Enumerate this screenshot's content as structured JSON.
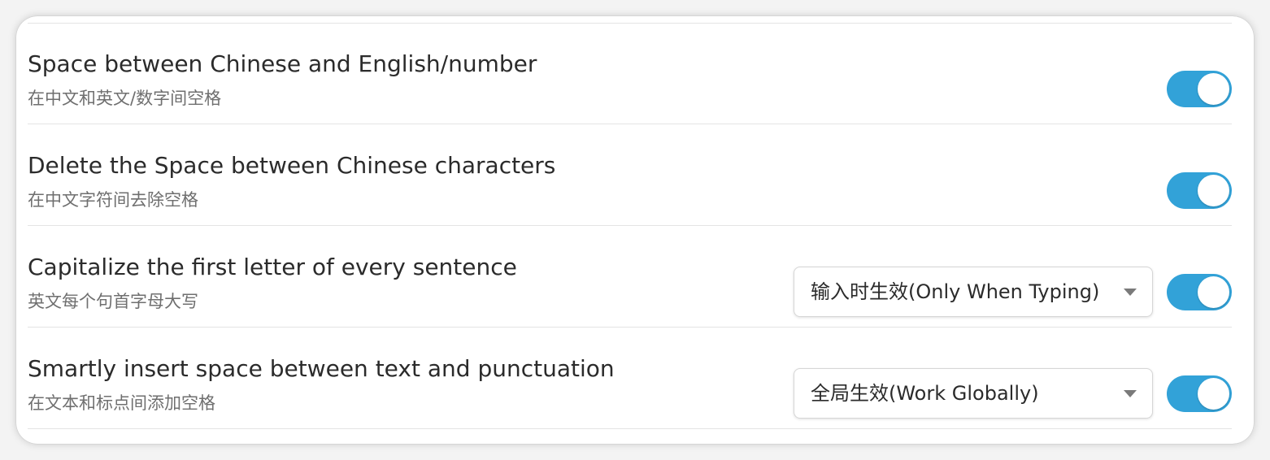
{
  "settings": [
    {
      "title": "Space between Chinese and English/number",
      "subtitle": "在中文和英文/数字间空格",
      "enabled": true
    },
    {
      "title": "Delete the Space between Chinese characters",
      "subtitle": "在中文字符间去除空格",
      "enabled": true
    },
    {
      "title": "Capitalize the first letter of every sentence",
      "subtitle": "英文每个句首字母大写",
      "scope": "输入时生效(Only When Typing)",
      "enabled": true
    },
    {
      "title": "Smartly insert space between text and punctuation",
      "subtitle": "在文本和标点间添加空格",
      "scope": "全局生效(Work Globally)",
      "enabled": true
    }
  ],
  "colors": {
    "toggle_on": "#32a2d8",
    "title_text": "#2b2b2b",
    "subtitle_text": "#6f6f6f"
  }
}
